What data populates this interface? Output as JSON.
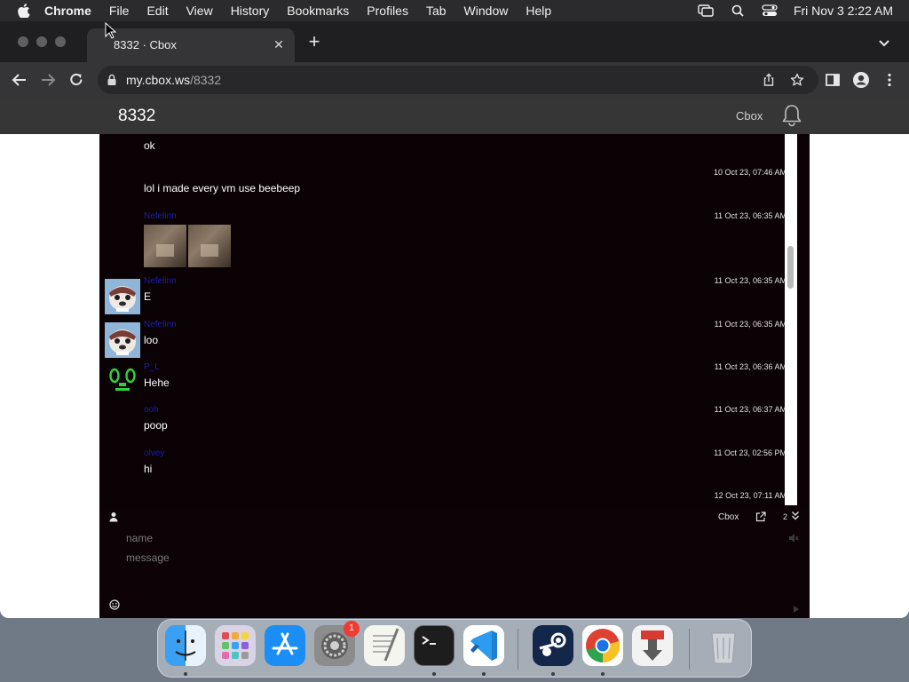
{
  "menubar": {
    "app_name": "Chrome",
    "items": [
      "File",
      "Edit",
      "View",
      "History",
      "Bookmarks",
      "Profiles",
      "Tab",
      "Window",
      "Help"
    ],
    "clock": "Fri Nov 3  2:22 AM"
  },
  "browser": {
    "tab_title": "8332 · Cbox",
    "url_host": "my.cbox.ws",
    "url_path": "/8332"
  },
  "site": {
    "room_title": "8332",
    "brand": "Cbox"
  },
  "messages": [
    {
      "name": "",
      "text": "ok",
      "time": "",
      "avatar": "none"
    },
    {
      "name": "",
      "text": "lol i made every vm use beebeep",
      "time": "10 Oct 23, 07:46 AM",
      "avatar": "none"
    },
    {
      "name": "Nefelinn",
      "text": "",
      "time": "11 Oct 23, 06:35 AM",
      "avatar": "none",
      "images": 2
    },
    {
      "name": "Nefelinn",
      "text": "E",
      "time": "11 Oct 23, 06:35 AM",
      "avatar": "otter"
    },
    {
      "name": "Nefelinn",
      "text": "loo",
      "time": "11 Oct 23, 06:35 AM",
      "avatar": "otter"
    },
    {
      "name": "P_L",
      "text": "Hehe",
      "time": "11 Oct 23, 06:36 AM",
      "avatar": "green-face"
    },
    {
      "name": "ooh",
      "text": "poop",
      "time": "11 Oct 23, 06:37 AM",
      "avatar": "none"
    },
    {
      "name": "olvey",
      "text": "hi",
      "time": "11 Oct 23, 02:56 PM",
      "avatar": "none"
    },
    {
      "name": "",
      "text": "",
      "time": "12 Oct 23, 07:11 AM",
      "avatar": "none"
    }
  ],
  "footer": {
    "brand": "Cbox",
    "online_count": "2",
    "name_placeholder": "name",
    "message_placeholder": "message"
  },
  "dock": {
    "apps": [
      "finder",
      "launchpad",
      "app-store",
      "system-settings",
      "textedit",
      "terminal",
      "vscode",
      "steam",
      "chrome",
      "downloader",
      "trash"
    ],
    "settings_badge": "1"
  },
  "colors": {
    "chat_background": "#0a0204",
    "username": "#1d1db0",
    "header": "#363636"
  }
}
